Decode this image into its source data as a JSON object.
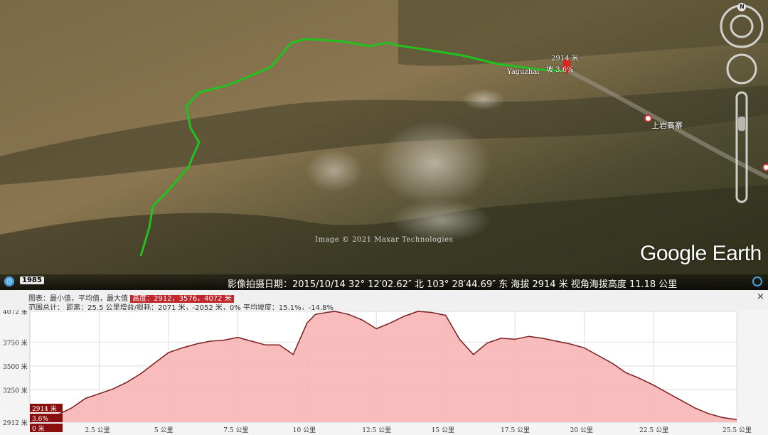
{
  "map": {
    "logo": "Google Earth",
    "attribution": "Image © 2021 Maxar Technologies",
    "place_label": "Yaguzhai",
    "village_label": "上岩高寨",
    "marker_elev": "2914 米",
    "marker_grade": "3.6%",
    "marker_prefix": "坡"
  },
  "status": {
    "year": "1985",
    "text": "影像拍摄日期：2015/10/14   32° 12′02.62″ 北 103° 28′44.69″ 东 海拔  2914 米   视角海拔高度  11.18 公里"
  },
  "compass": {
    "north": "N"
  },
  "profile": {
    "label_graph": "图表：最小值，平均值，最大值",
    "value_graph": "高度：2912，3576，4072 米",
    "label_totals": "范围总计：",
    "value_totals": "距离：25.5 公里增益/损耗：2071 米，-2052 米，0%  平均坡度：15.1%，-14.8%",
    "close": "×",
    "current_elev": "2914 米",
    "current_grade": "3.6%",
    "current_dist": "0 米"
  },
  "chart_data": {
    "type": "area",
    "xlabel": "",
    "ylabel": "",
    "x_ticks": [
      "2.5 公里",
      "5 公里",
      "7.5 公里",
      "10 公里",
      "12.5 公里",
      "15 公里",
      "17.5 公里",
      "20 公里",
      "22.5 公里",
      "25.5 公里"
    ],
    "x_tick_values": [
      2.5,
      5,
      7.5,
      10,
      12.5,
      15,
      17.5,
      20,
      22.5,
      25.5
    ],
    "y_ticks": [
      "2912 米",
      "3250 米",
      "3500 米",
      "3750 米",
      "4072 米"
    ],
    "y_tick_values": [
      2912,
      3250,
      3500,
      3750,
      4072
    ],
    "xlim": [
      0,
      25.5
    ],
    "ylim": [
      2912,
      4072
    ],
    "x": [
      0,
      0.5,
      1,
      1.5,
      2,
      2.5,
      3,
      3.5,
      4,
      4.5,
      5,
      5.5,
      6,
      6.5,
      7,
      7.5,
      8,
      8.5,
      9,
      9.5,
      10,
      10.3,
      10.7,
      11,
      11.5,
      12,
      12.5,
      13,
      13.5,
      14,
      14.5,
      15,
      15.5,
      16,
      16.5,
      17,
      17.5,
      18,
      18.5,
      19,
      19.5,
      20,
      20.5,
      21,
      21.5,
      22,
      22.5,
      23,
      23.5,
      24,
      24.5,
      25,
      25.5
    ],
    "y": [
      2914,
      2940,
      2990,
      3060,
      3160,
      3210,
      3260,
      3330,
      3420,
      3530,
      3640,
      3690,
      3730,
      3760,
      3770,
      3800,
      3760,
      3720,
      3720,
      3620,
      3950,
      4040,
      4060,
      4072,
      4040,
      3980,
      3890,
      3950,
      4020,
      4072,
      4060,
      4030,
      3780,
      3620,
      3740,
      3790,
      3780,
      3810,
      3790,
      3760,
      3730,
      3690,
      3610,
      3530,
      3430,
      3370,
      3300,
      3220,
      3140,
      3060,
      3000,
      2960,
      2940
    ],
    "fill_color": "#f7b0b0",
    "line_color": "#7a1e1e",
    "grid": true
  }
}
